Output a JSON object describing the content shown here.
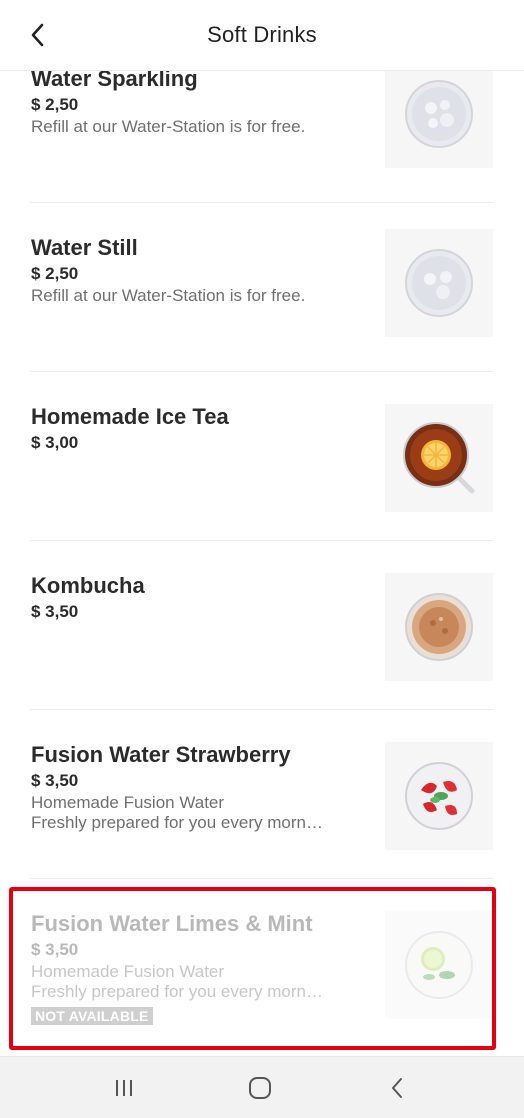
{
  "header": {
    "title": "Soft Drinks",
    "back_icon": "chevron-left-icon"
  },
  "items": [
    {
      "name": "Water Sparkling",
      "price": "$ 2,50",
      "desc1": "Refill at our Water-Station is for free.",
      "image": "sparkling-water-glass"
    },
    {
      "name": "Water Still",
      "price": "$ 2,50",
      "desc1": "Refill at our Water-Station is for free.",
      "image": "still-water-glass"
    },
    {
      "name": "Homemade Ice Tea",
      "price": "$ 3,00",
      "image": "ice-tea-glass"
    },
    {
      "name": "Kombucha",
      "price": "$ 3,50",
      "image": "kombucha-glass"
    },
    {
      "name": "Fusion Water Strawberry",
      "price": "$ 3,50",
      "desc1": "Homemade Fusion Water",
      "desc2": "Freshly prepared for you every morn…",
      "image": "strawberry-fusion-water-glass"
    },
    {
      "name": "Fusion Water Limes & Mint",
      "price": "$ 3,50",
      "desc1": "Homemade Fusion Water",
      "desc2": "Freshly prepared for you every morn…",
      "badge": "NOT AVAILABLE",
      "available": false,
      "image": "lime-mint-fusion-water-glass"
    }
  ],
  "colors": {
    "highlight": "#e4000f",
    "text": "#2b2b2b",
    "muted": "#6f6f6f",
    "disabled": "#b8b8b8"
  },
  "navbar": {
    "recents_icon": "recent-apps-icon",
    "home_icon": "home-icon",
    "back_icon": "back-icon"
  }
}
